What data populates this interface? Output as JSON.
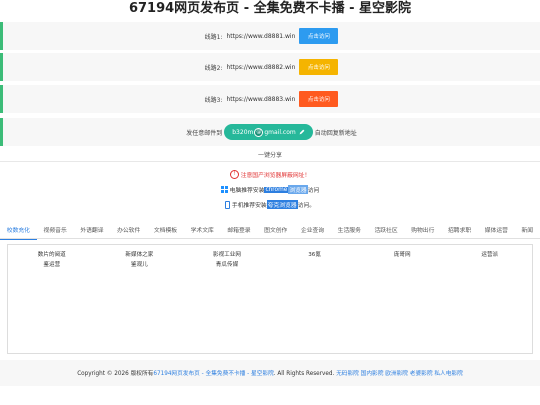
{
  "page": {
    "title": "67194网页发布页 - 全集免费不卡播 - 星空影院"
  },
  "lines": [
    {
      "label": "线路1:",
      "url": "https://www.d8881.win",
      "button": "点击访问",
      "color": "#2d9bf0"
    },
    {
      "label": "线路2:",
      "url": "https://www.d8882.win",
      "button": "点击访问",
      "color": "#f5b400"
    },
    {
      "label": "线路3:",
      "url": "https://www.d8883.win",
      "button": "点击访问",
      "color": "#ff5a1f"
    }
  ],
  "mail": {
    "prefix": "发任意邮件到",
    "address_left": "b320m",
    "address_right": "gmail.com",
    "suffix": "自动回复新地址"
  },
  "share": {
    "label": "一键分享"
  },
  "notices": {
    "warning": "注意国产浏览器屏蔽网址！",
    "pc_prefix": "电脑推荐安装",
    "pc_highlight_1": "chrome",
    "pc_highlight_2": "浏览器",
    "pc_suffix": "访问",
    "mobile_prefix": "手机推荐安装",
    "mobile_highlight": "夸克浏览器",
    "mobile_suffix": "访问。"
  },
  "tabs": [
    {
      "label": "校数充化",
      "active": true
    },
    {
      "label": "视频音乐",
      "active": false
    },
    {
      "label": "外语翻译",
      "active": false
    },
    {
      "label": "办公软件",
      "active": false
    },
    {
      "label": "文档模板",
      "active": false
    },
    {
      "label": "学术文库",
      "active": false
    },
    {
      "label": "邮箱登录",
      "active": false
    },
    {
      "label": "图文创作",
      "active": false
    },
    {
      "label": "企业查询",
      "active": false
    },
    {
      "label": "生活服务",
      "active": false
    },
    {
      "label": "活跃社区",
      "active": false
    },
    {
      "label": "购物出行",
      "active": false
    },
    {
      "label": "招聘求职",
      "active": false
    },
    {
      "label": "媒体运营",
      "active": false
    },
    {
      "label": "新闻",
      "active": false
    }
  ],
  "links": [
    [
      "数片的阅道",
      "新媒体之家",
      "影视工业网",
      "36氪",
      "庞哥网",
      "运营派"
    ],
    [
      "鉴运营",
      "鉴观儿",
      "青瓜传媒",
      "",
      "",
      ""
    ]
  ],
  "footer": {
    "prefix": "Copyright © 2026 版权所有",
    "site_link": "67194网页发布页 - 全集免费不卡播 - 星空影院",
    "rights": ". All Rights Reserved.",
    "links": [
      "无码影院",
      "国内影院",
      "欧洲影院",
      "老婆影院",
      "私人电影院"
    ]
  }
}
